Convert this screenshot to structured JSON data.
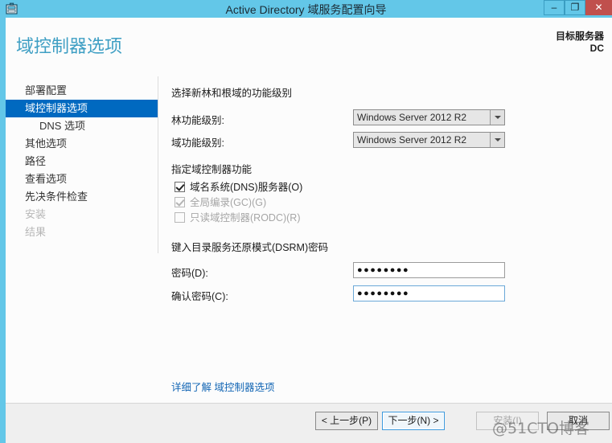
{
  "window": {
    "title": "Active Directory 域服务配置向导",
    "icon": "server-wizard-icon",
    "minimize_label": "–",
    "maximize_label": "❐",
    "close_label": "✕",
    "accent_color": "#63c7e8",
    "close_color": "#c0504d"
  },
  "header": {
    "page_title": "域控制器选项",
    "target_server_label": "目标服务器",
    "target_server_name": "DC",
    "title_color": "#3f9fc4"
  },
  "sidebar": {
    "items": [
      {
        "label": "部署配置",
        "state": "normal",
        "indent": false
      },
      {
        "label": "域控制器选项",
        "state": "selected",
        "indent": false
      },
      {
        "label": "DNS 选项",
        "state": "normal",
        "indent": true
      },
      {
        "label": "其他选项",
        "state": "normal",
        "indent": false
      },
      {
        "label": "路径",
        "state": "normal",
        "indent": false
      },
      {
        "label": "查看选项",
        "state": "normal",
        "indent": false
      },
      {
        "label": "先决条件检查",
        "state": "normal",
        "indent": false
      },
      {
        "label": "安装",
        "state": "disabled",
        "indent": false
      },
      {
        "label": "结果",
        "state": "disabled",
        "indent": false
      }
    ],
    "selected_color": "#0069c0"
  },
  "content": {
    "functional_level_heading": "选择新林和根域的功能级别",
    "forest_level_label": "林功能级别:",
    "forest_level_value": "Windows Server 2012 R2",
    "domain_level_label": "域功能级别:",
    "domain_level_value": "Windows Server 2012 R2",
    "capabilities_heading": "指定域控制器功能",
    "checkboxes": [
      {
        "label": "域名系统(DNS)服务器(O)",
        "accel": "O",
        "checked": true,
        "disabled": false
      },
      {
        "label": "全局编录(GC)(G)",
        "accel": "G",
        "checked": true,
        "disabled": true
      },
      {
        "label": "只读域控制器(RODC)(R)",
        "accel": "R",
        "checked": false,
        "disabled": true
      }
    ],
    "dsrm_heading": "键入目录服务还原模式(DSRM)密码",
    "password_label": "密码(D):",
    "password_value": "●●●●●●●●",
    "confirm_label": "确认密码(C):",
    "confirm_value": "●●●●●●●●",
    "learn_more_link": "详细了解 域控制器选项",
    "link_color": "#1567b5"
  },
  "footer": {
    "previous_label": "< 上一步(P)",
    "next_label": "下一步(N) >",
    "install_label": "安装(I)",
    "cancel_label": "取消",
    "install_disabled": true,
    "next_focused": true
  },
  "overlay": {
    "watermark": "@51CTO博客"
  }
}
